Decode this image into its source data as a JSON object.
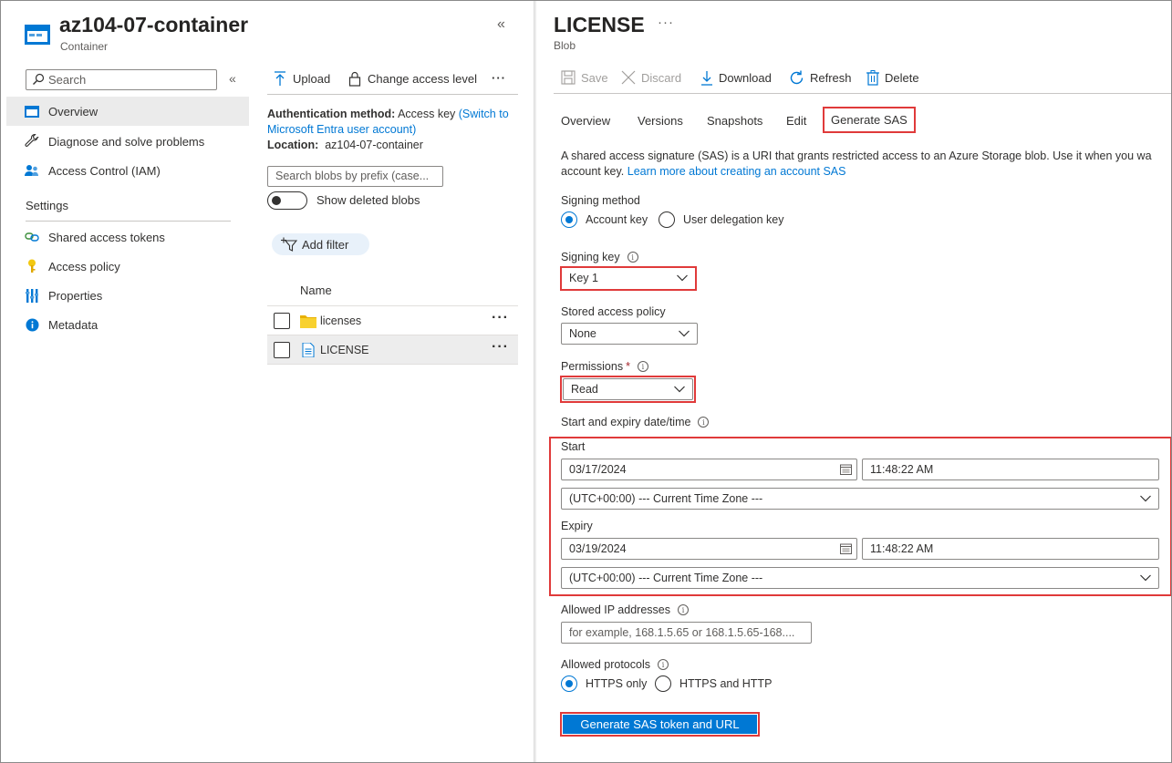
{
  "container": {
    "title": "az104-07-container",
    "subtitle": "Container",
    "collapse": "«"
  },
  "nav": {
    "search_placeholder": "Search",
    "collapse": "«",
    "items": [
      {
        "label": "Overview",
        "icon": "container-icon",
        "active": true
      },
      {
        "label": "Diagnose and solve problems",
        "icon": "wrench-icon"
      },
      {
        "label": "Access Control (IAM)",
        "icon": "iam-people-icon"
      }
    ],
    "settings_header": "Settings",
    "settings_items": [
      {
        "label": "Shared access tokens",
        "icon": "link-icon"
      },
      {
        "label": "Access policy",
        "icon": "key-icon"
      },
      {
        "label": "Properties",
        "icon": "properties-icon"
      },
      {
        "label": "Metadata",
        "icon": "info-icon"
      }
    ]
  },
  "container_toolbar": {
    "upload": "Upload",
    "change_access": "Change access level",
    "more": "···"
  },
  "auth": {
    "method_label": "Authentication method:",
    "method_value": "Access key",
    "switch_link": "(Switch to Microsoft Entra user account)",
    "location_label": "Location:",
    "location_value": "az104-07-container"
  },
  "blob_search_placeholder": "Search blobs by prefix (case...",
  "show_deleted": "Show deleted blobs",
  "add_filter": "Add filter",
  "list": {
    "column_name": "Name",
    "rows": [
      {
        "name": "licenses",
        "type": "folder",
        "more": "···"
      },
      {
        "name": "LICENSE",
        "type": "file",
        "more": "···",
        "selected": true
      }
    ]
  },
  "blob": {
    "title": "LICENSE",
    "more": "···",
    "subtitle": "Blob"
  },
  "blob_toolbar": {
    "save": "Save",
    "discard": "Discard",
    "download": "Download",
    "refresh": "Refresh",
    "delete": "Delete"
  },
  "tabs": [
    "Overview",
    "Versions",
    "Snapshots",
    "Edit",
    "Generate SAS"
  ],
  "description": {
    "text1": "A shared access signature (SAS) is a URI that grants restricted access to an Azure Storage blob. Use it when you wa",
    "text2": "account key.",
    "link": "Learn more about creating an account SAS"
  },
  "form": {
    "signing_method_label": "Signing method",
    "signing_method_options": [
      "Account key",
      "User delegation key"
    ],
    "signing_method_selected": "Account key",
    "signing_key_label": "Signing key",
    "signing_key_value": "Key 1",
    "stored_policy_label": "Stored access policy",
    "stored_policy_value": "None",
    "permissions_label": "Permissions",
    "permissions_required": "*",
    "permissions_value": "Read",
    "dates_label": "Start and expiry date/time",
    "start_label": "Start",
    "start_date": "03/17/2024",
    "start_time": "11:48:22 AM",
    "start_tz": "(UTC+00:00) --- Current Time Zone ---",
    "expiry_label": "Expiry",
    "expiry_date": "03/19/2024",
    "expiry_time": "11:48:22 AM",
    "expiry_tz": "(UTC+00:00) --- Current Time Zone ---",
    "ip_label": "Allowed IP addresses",
    "ip_placeholder": "for example, 168.1.5.65 or 168.1.5.65-168....",
    "protocols_label": "Allowed protocols",
    "protocol_options": [
      "HTTPS only",
      "HTTPS and HTTP"
    ],
    "protocol_selected": "HTTPS only",
    "generate_button": "Generate SAS token and URL"
  },
  "colors": {
    "accent": "#0078d4",
    "highlight": "#e03a3a"
  }
}
